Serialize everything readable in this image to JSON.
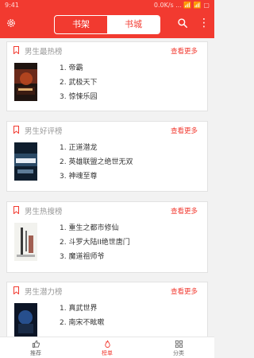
{
  "status": {
    "time": "9:41",
    "right": "0.0K/s ... 📶 📶 ▢"
  },
  "header": {
    "tabs": [
      {
        "label": "书架",
        "active": false
      },
      {
        "label": "书城",
        "active": true
      }
    ],
    "icons": [
      "gear-icon",
      "search-icon",
      "more-vertical-icon"
    ]
  },
  "sections": [
    {
      "title": "男生最热榜",
      "more": "查看更多",
      "items": [
        "1. 帝霸",
        "2. 武极天下",
        "3. 惊悚乐园"
      ]
    },
    {
      "title": "男生好评榜",
      "more": "查看更多",
      "items": [
        "1. 正道潜龙",
        "2. 英雄联盟之绝世无双",
        "3. 神魂至尊"
      ]
    },
    {
      "title": "男生热搜榜",
      "more": "查看更多",
      "items": [
        "1. 重生之都市修仙",
        "2. 斗罗大陆II绝世唐门",
        "3. 魔道祖师爷"
      ]
    },
    {
      "title": "男生潜力榜",
      "more": "查看更多",
      "items": [
        "1. 真武世界",
        "2. 南宋不眩嗽"
      ]
    }
  ],
  "bottom_nav": [
    {
      "label": "推荐",
      "icon": "thumbs-up-icon",
      "active": false
    },
    {
      "label": "榜单",
      "icon": "flame-icon",
      "active": true
    },
    {
      "label": "分类",
      "icon": "grid-icon",
      "active": false
    }
  ],
  "colors": {
    "brand": "#f23a30",
    "more": "#f23a30",
    "title": "#999999"
  }
}
